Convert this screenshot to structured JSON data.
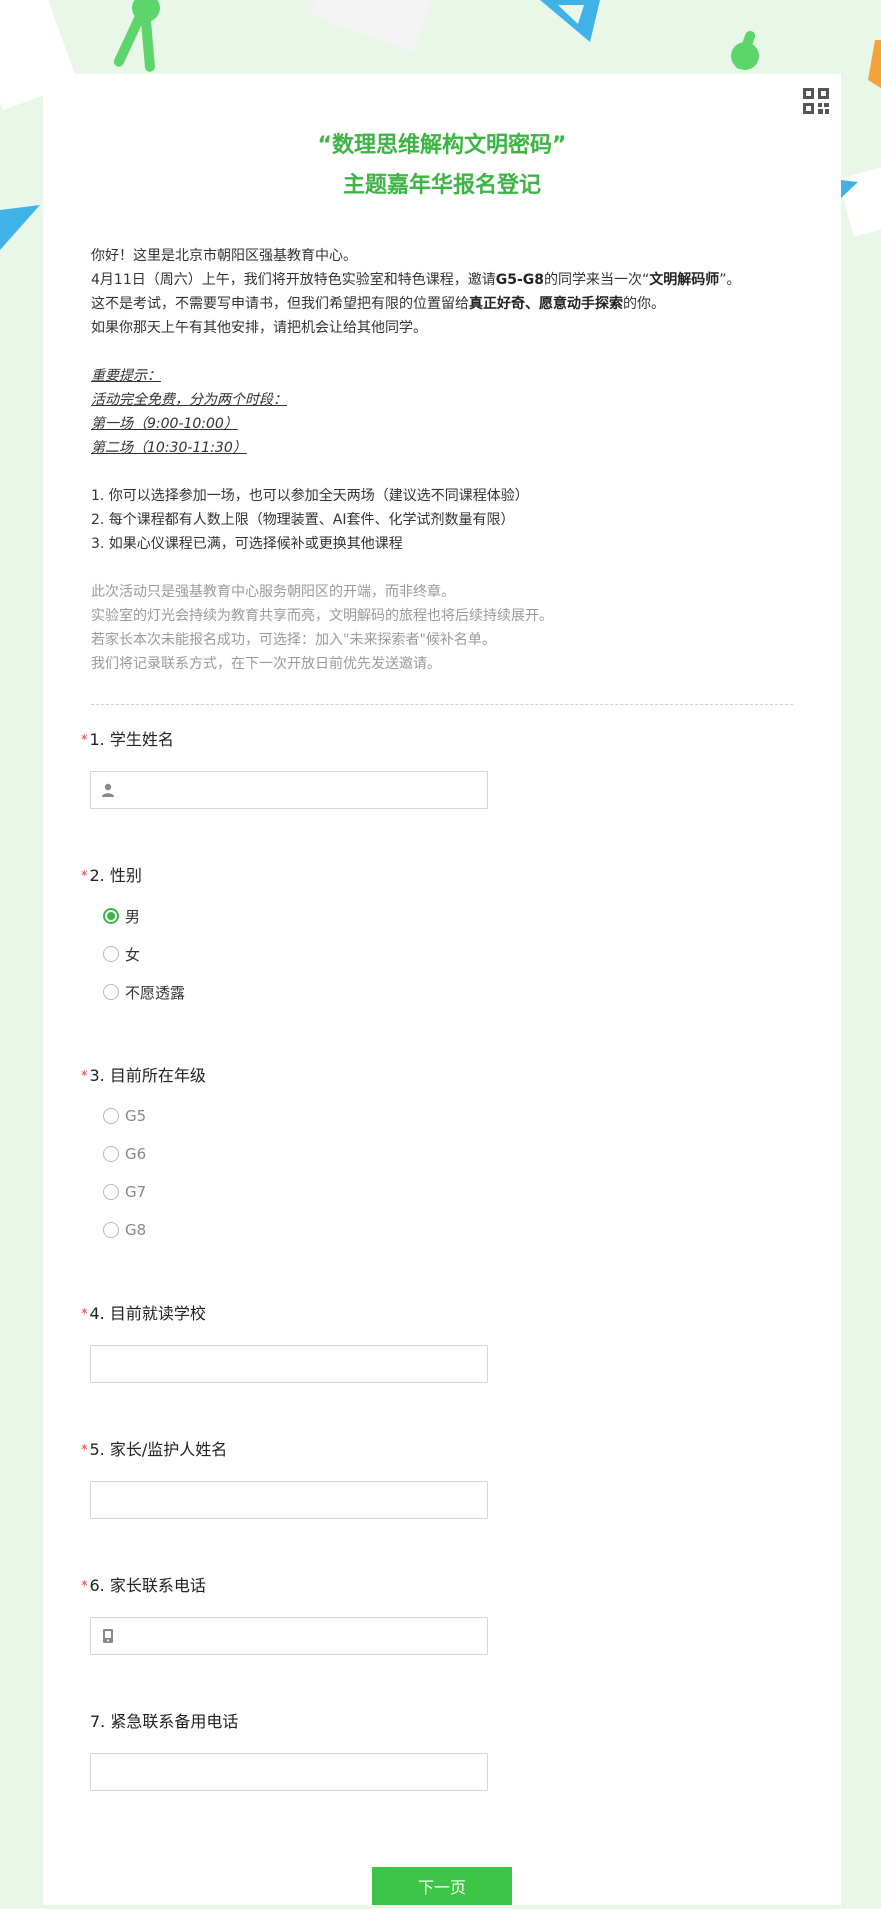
{
  "form": {
    "title_line1": "“数理思维解构文明密码”",
    "title_line2": "主题嘉年华报名登记",
    "accent_color": "#3cb545",
    "intro": {
      "greeting": "你好！这里是北京市朝阳区强基教育中心。",
      "l2_a": "4月11日（周六）上午，我们将开放特色实验室和特色课程，邀请",
      "l2_b": "G5-G8",
      "l2_c": "的同学来当一次“",
      "l2_d": "文明解码师",
      "l2_e": "”。",
      "l3_a": "这不是考试，不需要写申请书，但我们希望把有限的位置留给",
      "l3_b": "真正好奇、愿意动手探索",
      "l3_c": "的你。",
      "l4": "如果你那天上午有其他安排，请把机会让给其他同学。",
      "note1": "重要提示：",
      "note2": "活动完全免费，分为两个时段：",
      "note3": "第一场（9:00-10:00）",
      "note4": "第二场（10:30-11:30）",
      "rule1": "1. 你可以选择参加一场，也可以参加全天两场（建议选不同课程体验）",
      "rule2": "2. 每个课程都有人数上限（物理装置、AI套件、化学试剂数量有限）",
      "rule3": "3. 如果心仪课程已满，可选择候补或更换其他课程",
      "gray1": "此次活动只是强基教育中心服务朝阳区的开端，而非终章。",
      "gray2": "实验室的灯光会持续为教育共享而亮，文明解码的旅程也将后续持续展开。",
      "gray3": "若家长本次未能报名成功，可选择：加入\"未来探索者\"候补名单。",
      "gray4": "我们将记录联系方式，在下一次开放日前优先发送邀请。"
    },
    "required_mark": "*",
    "q1": {
      "title": "1. 学生姓名",
      "value": ""
    },
    "q2": {
      "title": "2. 性别",
      "options": [
        "男",
        "女",
        "不愿透露"
      ],
      "selected": "男"
    },
    "q3": {
      "title": "3. 目前所在年级",
      "options": [
        "G5",
        "G6",
        "G7",
        "G8"
      ]
    },
    "q4": {
      "title": "4. 目前就读学校",
      "value": ""
    },
    "q5": {
      "title": "5. 家长/监护人姓名",
      "value": ""
    },
    "q6": {
      "title": "6. 家长联系电话",
      "value": ""
    },
    "q7": {
      "title": "7. 紧急联系备用电话",
      "value": ""
    },
    "next_label": "下一页"
  }
}
